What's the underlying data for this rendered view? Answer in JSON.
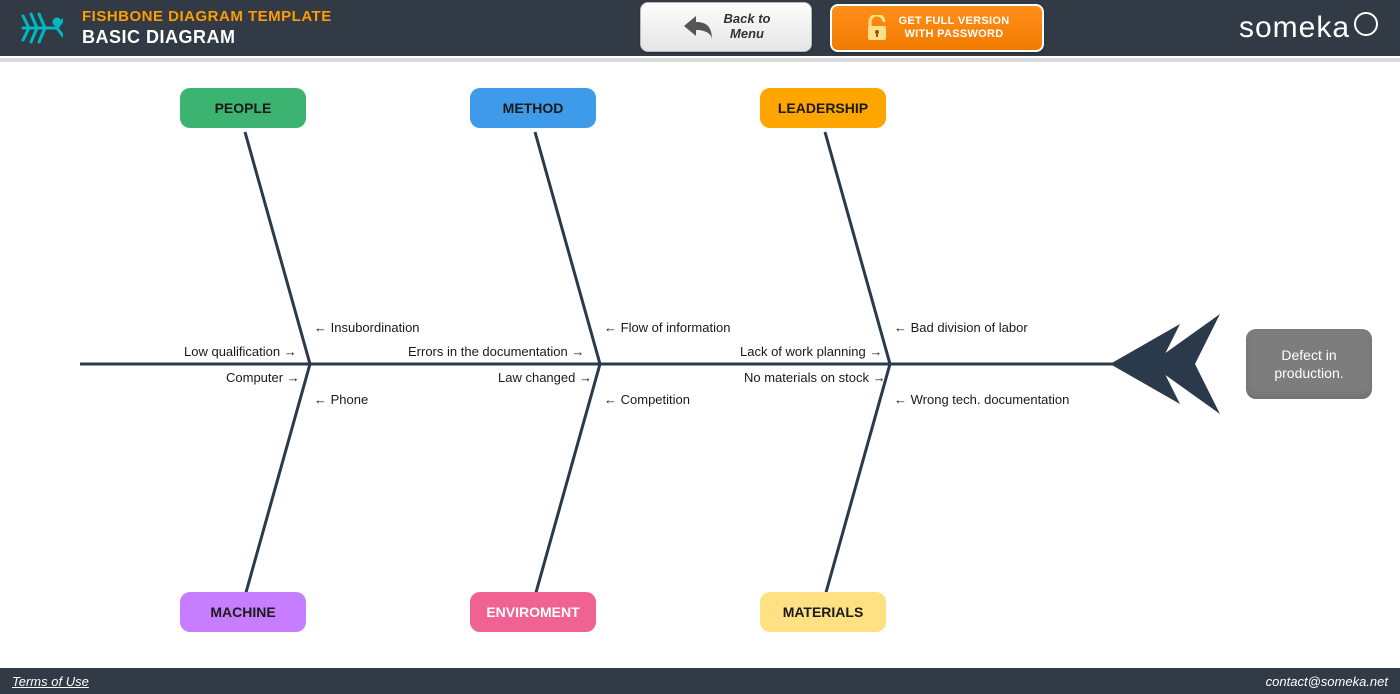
{
  "header": {
    "small_title": "FISHBONE DIAGRAM TEMPLATE",
    "big_title": "BASIC DIAGRAM",
    "back_label": "Back to\nMenu",
    "full_label": "GET FULL VERSION\nWITH PASSWORD",
    "brand": "someka"
  },
  "colors": {
    "people": "#3cb371",
    "method": "#3d9be9",
    "leadership": "#ffa500",
    "machine": "#c77dff",
    "enviroment": "#f06292",
    "materials": "#ffe082",
    "spine": "#2b3a4a",
    "effect": "#7d7d7d"
  },
  "diagram": {
    "effect": "Defect in production.",
    "top_categories": [
      {
        "key": "people",
        "label": "PEOPLE"
      },
      {
        "key": "method",
        "label": "METHOD"
      },
      {
        "key": "leadership",
        "label": "LEADERSHIP"
      }
    ],
    "bottom_categories": [
      {
        "key": "machine",
        "label": "MACHINE"
      },
      {
        "key": "enviroment",
        "label": "ENVIROMENT"
      },
      {
        "key": "materials",
        "label": "MATERIALS"
      }
    ],
    "causes": {
      "people_top": [
        "Insubordination"
      ],
      "people_spine": [
        "Low qualification"
      ],
      "method_top": [
        "Flow of information"
      ],
      "method_spine": [
        "Errors in the documentation"
      ],
      "leadership_top": [
        "Bad division of labor"
      ],
      "leadership_spine": [
        "Lack of work planning"
      ],
      "machine_top": [
        "Phone"
      ],
      "machine_spine": [
        "Computer"
      ],
      "enviroment_top": [
        "Competition"
      ],
      "enviroment_spine": [
        "Law changed"
      ],
      "materials_top": [
        "Wrong  tech. documentation"
      ],
      "materials_spine": [
        "No materials on stock"
      ]
    }
  },
  "footer": {
    "terms": "Terms of Use",
    "email": "contact@someka.net"
  }
}
